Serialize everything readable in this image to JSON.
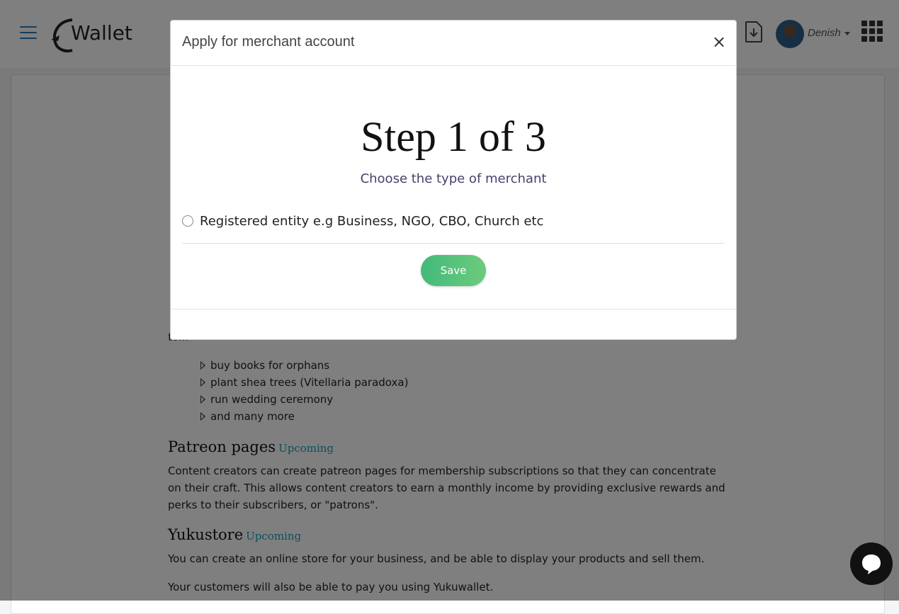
{
  "navbar": {
    "logo_text": "Wallet",
    "user_name": "Denish"
  },
  "content": {
    "fragment_1": "to...",
    "bullets": [
      "buy books for orphans",
      "plant shea trees (Vitellaria paradoxa)",
      "run wedding ceremony",
      "and many more"
    ],
    "patreon": {
      "title": "Patreon pages",
      "badge": "Upcoming",
      "text": "Content creators can create patreon pages for membership subscriptions so that they can concentrate on their craft. This allows content creators to earn a monthly income by providing exclusive rewards and perks to their subscribers, or \"patrons\"."
    },
    "yukustore": {
      "title": "Yukustore",
      "badge": "Upcoming",
      "text_1": "You can create an online store for your business, and be able to display your products and sell them.",
      "text_2": "Your customers will also be able to pay you using Yukuwallet."
    }
  },
  "modal": {
    "title": "Apply for merchant account",
    "close_symbol": "×",
    "step_title": "Step 1 of 3",
    "step_subtitle": "Choose the type of merchant",
    "radio_label": "Registered entity e.g Business, NGO, CBO, Church etc",
    "save_label": "Save"
  },
  "icons": {
    "menu": "hamburger-menu-icon",
    "download": "file-download-icon",
    "apps": "apps-grid-icon",
    "chat": "chat-bubble-icon"
  },
  "colors": {
    "accent": "#2b7bb9",
    "save_button": "#4cbf7a",
    "upcoming_badge": "#17a2b8",
    "subtitle": "#4a3f6b"
  }
}
